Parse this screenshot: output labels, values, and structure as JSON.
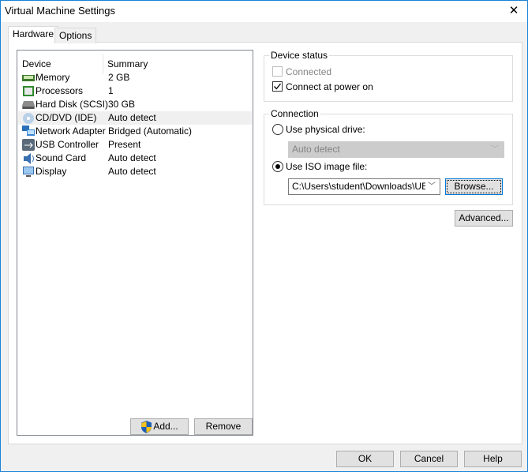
{
  "window": {
    "title": "Virtual Machine Settings",
    "close_glyph": "✕"
  },
  "tabs": [
    {
      "label": "Hardware"
    },
    {
      "label": "Options"
    }
  ],
  "device_list": {
    "headers": {
      "device": "Device",
      "summary": "Summary"
    },
    "rows": [
      {
        "device": "Memory",
        "summary": "2 GB",
        "icon": "memory-icon"
      },
      {
        "device": "Processors",
        "summary": "1",
        "icon": "processor-icon"
      },
      {
        "device": "Hard Disk (SCSI)",
        "summary": "30 GB",
        "icon": "hard-disk-icon"
      },
      {
        "device": "CD/DVD (IDE)",
        "summary": "Auto detect",
        "icon": "cd-dvd-icon",
        "selected": true
      },
      {
        "device": "Network Adapter",
        "summary": "Bridged (Automatic)",
        "icon": "network-adapter-icon"
      },
      {
        "device": "USB Controller",
        "summary": "Present",
        "icon": "usb-icon"
      },
      {
        "device": "Sound Card",
        "summary": "Auto detect",
        "icon": "sound-card-icon"
      },
      {
        "device": "Display",
        "summary": "Auto detect",
        "icon": "display-icon"
      }
    ],
    "add_label": "Add...",
    "remove_label": "Remove"
  },
  "device_status": {
    "title": "Device status",
    "connected_label": "Connected",
    "connected": false,
    "connected_enabled": false,
    "power_on_label": "Connect at power on",
    "power_on": true
  },
  "connection": {
    "title": "Connection",
    "physical_label": "Use physical drive:",
    "physical_value": "Auto detect",
    "iso_label": "Use ISO image file:",
    "iso_value": "C:\\Users\\student\\Downloads\\UBCD",
    "browse_label": "Browse...",
    "selected": "iso"
  },
  "advanced_label": "Advanced...",
  "footer": {
    "ok": "OK",
    "cancel": "Cancel",
    "help": "Help"
  }
}
